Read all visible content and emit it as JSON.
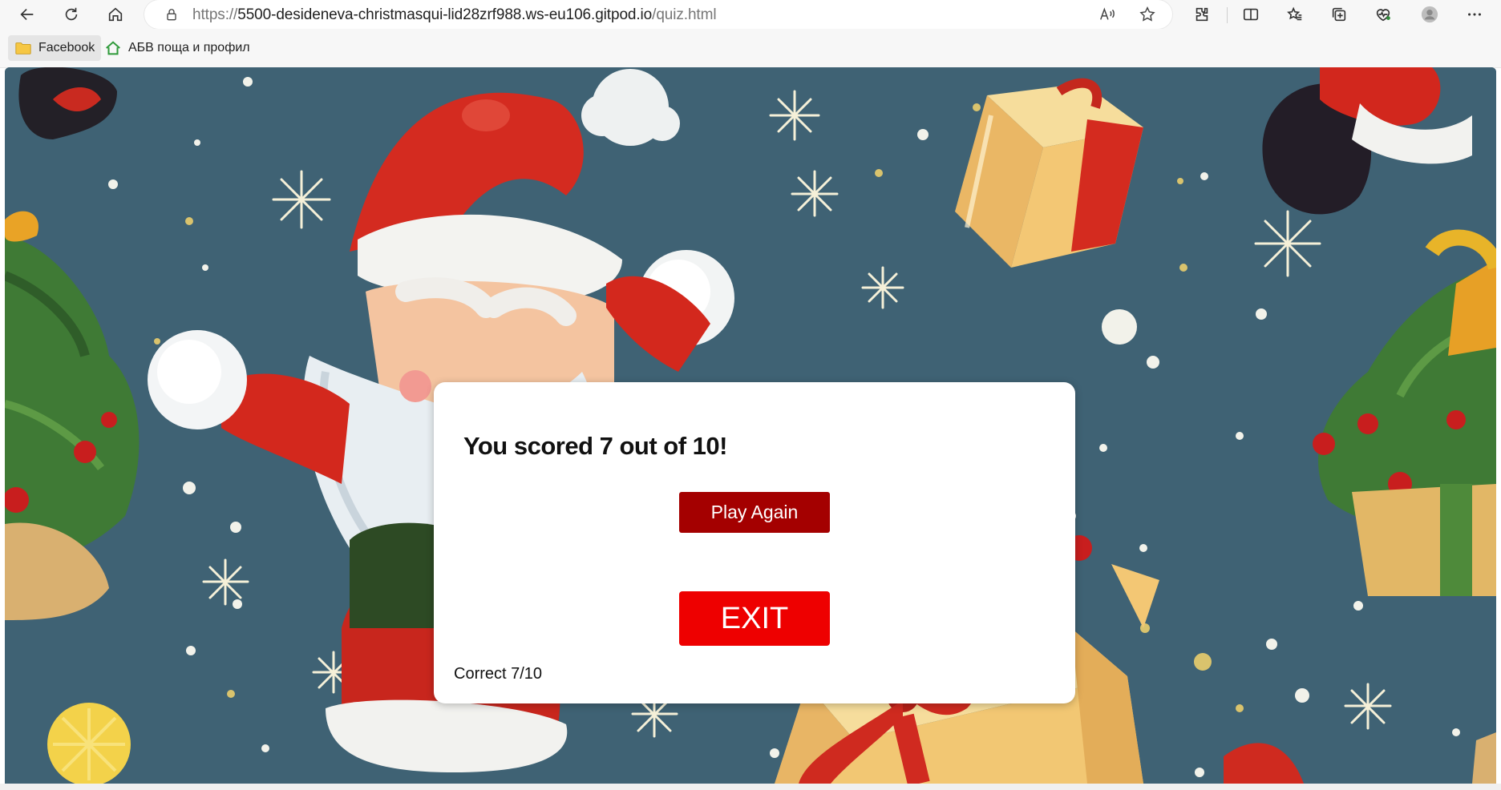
{
  "browser": {
    "url": {
      "scheme": "https://",
      "host": "5500-desideneva-christmasqui-lid28zrf988.ws-eu106.gitpod.io",
      "path": "/quiz.html"
    },
    "toolbar_icons": [
      "back-icon",
      "refresh-icon",
      "home-icon",
      "lock-icon",
      "read-aloud-icon",
      "favorite-star-icon",
      "extensions-icon",
      "split-screen-icon",
      "favorites-icon",
      "collections-icon",
      "browser-essentials-icon",
      "profile-icon",
      "more-icon"
    ]
  },
  "bookmarks": [
    {
      "label": "Facebook",
      "icon": "folder-icon"
    },
    {
      "label": "АБВ поща и профил",
      "icon": "house-icon"
    }
  ],
  "quiz_result": {
    "score_text": "You scored 7 out of 10!",
    "play_again_label": "Play Again",
    "exit_label": "EXIT",
    "correct_text": "Correct 7/10"
  },
  "colors": {
    "background_teal": "#3f6274",
    "play_again_button": "#a40000",
    "exit_button": "#ee0000",
    "modal": "#ffffff"
  }
}
